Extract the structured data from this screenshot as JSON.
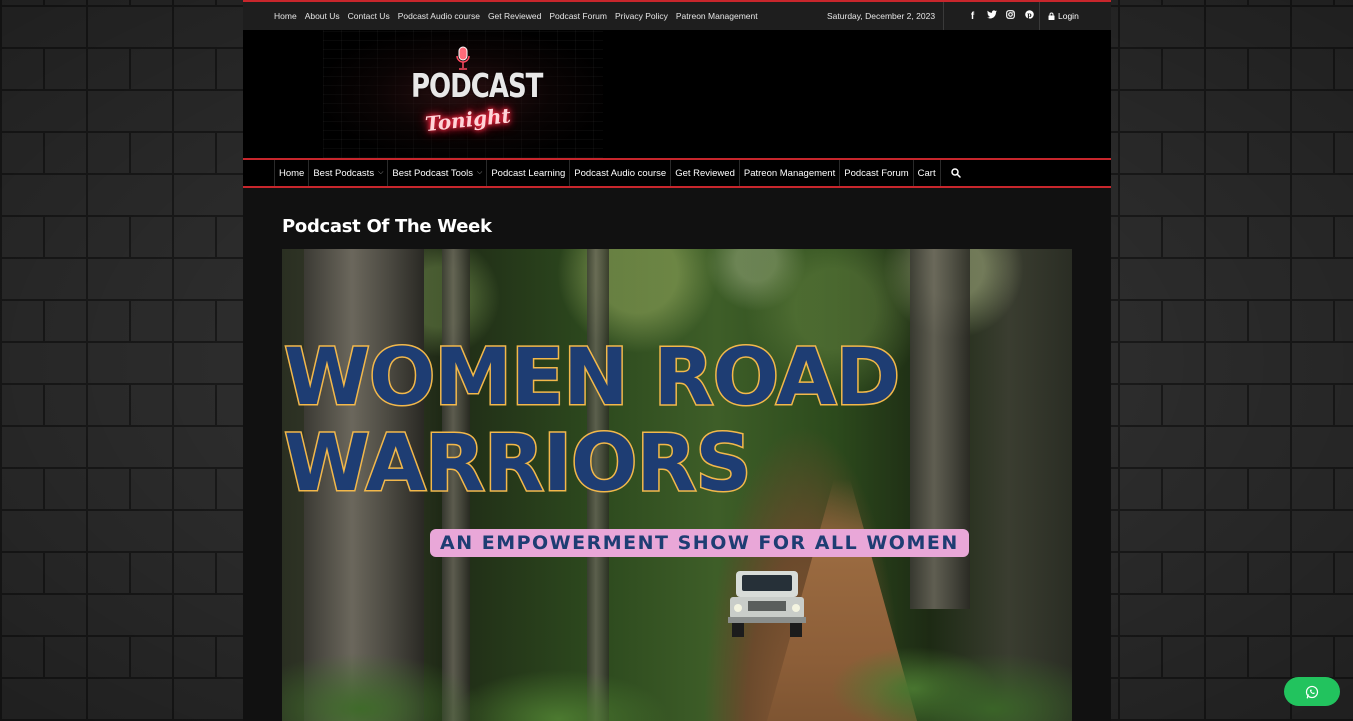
{
  "topbar": {
    "links": [
      "Home",
      "About Us",
      "Contact Us",
      "Podcast Audio course",
      "Get Reviewed",
      "Podcast Forum",
      "Privacy Policy",
      "Patreon Management"
    ],
    "date": "Saturday, December 2, 2023",
    "socials": [
      "facebook-icon",
      "twitter-icon",
      "instagram-icon",
      "pinterest-icon"
    ],
    "login": "Login"
  },
  "logo": {
    "line1": "PODCAST",
    "line2": "Tonight"
  },
  "mainnav": {
    "items": [
      {
        "label": "Home",
        "dropdown": false
      },
      {
        "label": "Best Podcasts",
        "dropdown": true
      },
      {
        "label": "Best Podcast Tools",
        "dropdown": true
      },
      {
        "label": "Podcast Learning",
        "dropdown": false
      },
      {
        "label": "Podcast Audio course",
        "dropdown": false
      },
      {
        "label": "Get Reviewed",
        "dropdown": false
      },
      {
        "label": "Patreon Management",
        "dropdown": false
      },
      {
        "label": "Podcast Forum",
        "dropdown": false
      },
      {
        "label": "Cart",
        "dropdown": false
      }
    ],
    "search_icon": "search-icon"
  },
  "content": {
    "section_title": "Podcast Of The Week",
    "hero": {
      "title_line1": "WOMEN ROAD",
      "title_line2": "WARRIORS",
      "tagline": "AN EMPOWERMENT SHOW FOR ALL WOMEN"
    }
  },
  "colors": {
    "accent_red": "#c8262c",
    "whatsapp_green": "#22c35e",
    "title_blue": "#1e3d73",
    "title_outline": "#f2b84b",
    "tagline_pink": "#e9a7d8"
  },
  "floating": {
    "whatsapp_icon": "whatsapp-icon"
  }
}
